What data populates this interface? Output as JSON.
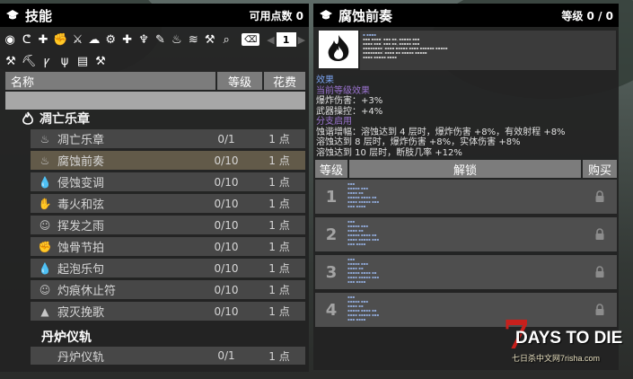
{
  "left": {
    "title": "技能",
    "points_label": "可用点数 0",
    "page": "1",
    "columns": {
      "name": "名称",
      "level": "等级",
      "cost": "花费"
    },
    "group": "凋亡乐章",
    "rows": [
      {
        "name": "凋亡乐章",
        "level": "0/1",
        "cost": "1 点",
        "icon": "flame-icon"
      },
      {
        "name": "腐蚀前奏",
        "level": "0/10",
        "cost": "1 点",
        "icon": "flame-icon"
      },
      {
        "name": "侵蚀变调",
        "level": "0/10",
        "cost": "1 点",
        "icon": "drop-icon"
      },
      {
        "name": "毒火和弦",
        "level": "0/10",
        "cost": "1 点",
        "icon": "burn-hand-icon"
      },
      {
        "name": "挥发之雨",
        "level": "0/10",
        "cost": "1 点",
        "icon": "face-icon"
      },
      {
        "name": "蚀骨节拍",
        "level": "0/10",
        "cost": "1 点",
        "icon": "fist-icon"
      },
      {
        "name": "起泡乐句",
        "level": "0/10",
        "cost": "1 点",
        "icon": "drop-icon"
      },
      {
        "name": "灼痕休止符",
        "level": "0/10",
        "cost": "1 点",
        "icon": "face-icon"
      },
      {
        "name": "寂灭挽歌",
        "level": "0/10",
        "cost": "1 点",
        "icon": "cap-icon"
      }
    ],
    "subgroup": "丹炉仪轨",
    "subrow": {
      "name": "丹炉仪轨",
      "level": "0/1",
      "cost": "1 点"
    }
  },
  "right": {
    "title": "腐蚀前奏",
    "level_label": "等级 0 / 0",
    "info": {
      "effect_header": "效果",
      "current_header": "当前等级效果",
      "lines_current": [
        "爆炸伤害：+3%",
        "武器操控：+4%"
      ],
      "branch_header": "分支启用",
      "lines_branch": [
        "蚀谐增幅：溶蚀达到 4 层时，爆炸伤害 +8%，有效射程 +8%",
        "溶蚀达到 8 层时，爆炸伤害 +8%，实体伤害 +8%",
        "溶蚀达到 10 层时，断肢几率 +12%"
      ]
    },
    "tiers_header": {
      "level": "等级",
      "unlock": "解锁",
      "buy": "购买"
    },
    "tiers": [
      "1",
      "2",
      "3",
      "4"
    ]
  },
  "watermark": {
    "big": "7",
    "title": "DAYS TO DIE",
    "sub": "七日杀中文网7risha.com"
  },
  "colors": {
    "accent_selected": "#625a49",
    "header_bg": "#000000",
    "effect_blue": "#7ba3f0",
    "branch_purple": "#9b74d0",
    "logo_red": "#c8201c"
  }
}
